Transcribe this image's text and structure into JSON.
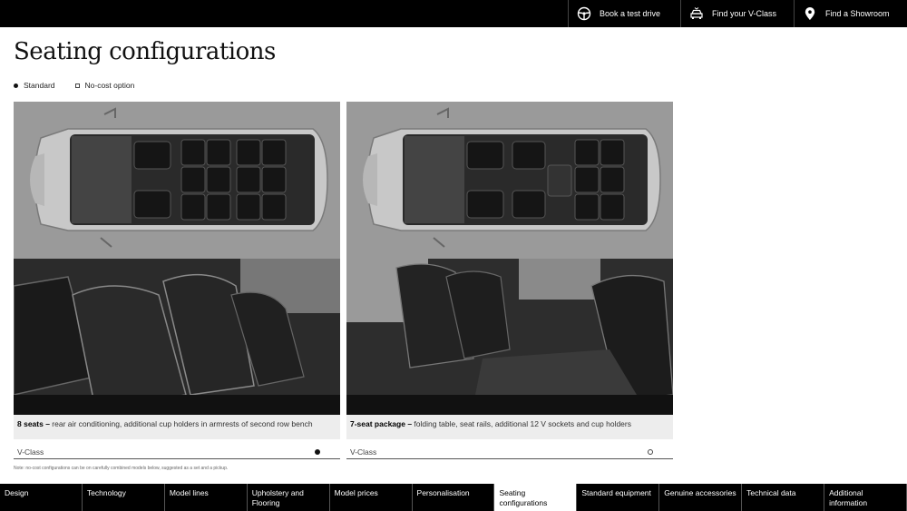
{
  "topbar": {
    "buttons": [
      {
        "label": "Book a test drive",
        "icon": "steering-wheel-icon"
      },
      {
        "label": "Find your V-Class",
        "icon": "car-search-icon"
      },
      {
        "label": "Find a Showroom",
        "icon": "location-pin-icon"
      }
    ]
  },
  "page": {
    "title": "Seating configurations",
    "legend": {
      "standard": "Standard",
      "no_cost": "No-cost option"
    }
  },
  "cards": [
    {
      "caption_bold": "8 seats –",
      "caption_text": " rear air conditioning, additional cup holders in armrests of second row bench",
      "model": "V-Class",
      "availability": "standard"
    },
    {
      "caption_bold": "7-seat package –",
      "caption_text": " folding table, seat rails, additional 12 V sockets and cup holders",
      "model": "V-Class",
      "availability": "no-cost option"
    }
  ],
  "footnote": "Note: no-cost configurations can be on carefully combined models below, suggested as a set and a pickup.",
  "bottomnav": {
    "items": [
      "Design",
      "Technology",
      "Model lines",
      "Upholstery and Flooring",
      "Model prices",
      "Personalisation",
      "Seating configurations",
      "Standard equipment",
      "Genuine accessories",
      "Technical data",
      "Additional information"
    ],
    "active_index": 6
  }
}
